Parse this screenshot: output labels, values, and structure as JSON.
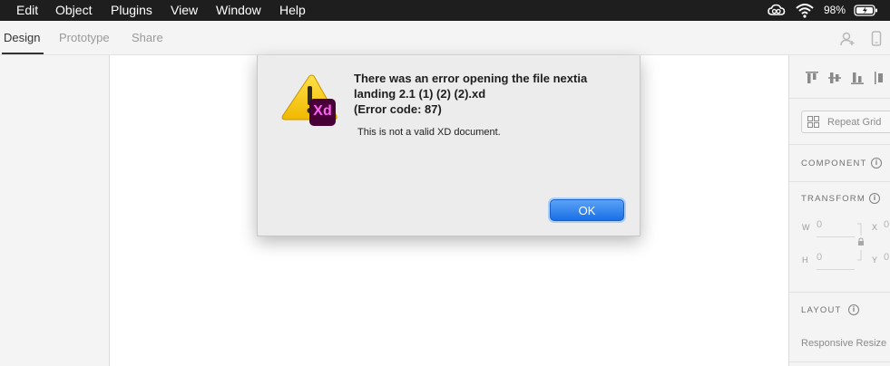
{
  "menubar": {
    "items": [
      "Edit",
      "Object",
      "Plugins",
      "View",
      "Window",
      "Help"
    ],
    "battery": "98%"
  },
  "tabs": [
    "Design",
    "Prototype",
    "Share"
  ],
  "dialog": {
    "title_line1": "There was an error opening the file nextia",
    "title_line2": "landing 2.1 (1) (2) (2).xd",
    "title_line3": "(Error code: 87)",
    "message": "This is not a valid XD document.",
    "ok_label": "OK",
    "badge_text": "Xd"
  },
  "right_panel": {
    "repeat_grid_label": "Repeat Grid",
    "component_heading": "COMPONENT",
    "transform_heading": "TRANSFORM",
    "layout_heading": "LAYOUT",
    "responsive_label": "Responsive Resize",
    "fields": {
      "w_label": "W",
      "w_value": "0",
      "h_label": "H",
      "h_value": "0",
      "x_label": "X",
      "x_value": "0",
      "y_label": "Y",
      "y_value": "0"
    }
  },
  "colors": {
    "menubar_bg": "#1e1e1e",
    "ok_button": "#1a6fe6",
    "xd_badge": "#470137",
    "xd_text": "#ff61f6",
    "warning_yellow": "#f5c400"
  }
}
